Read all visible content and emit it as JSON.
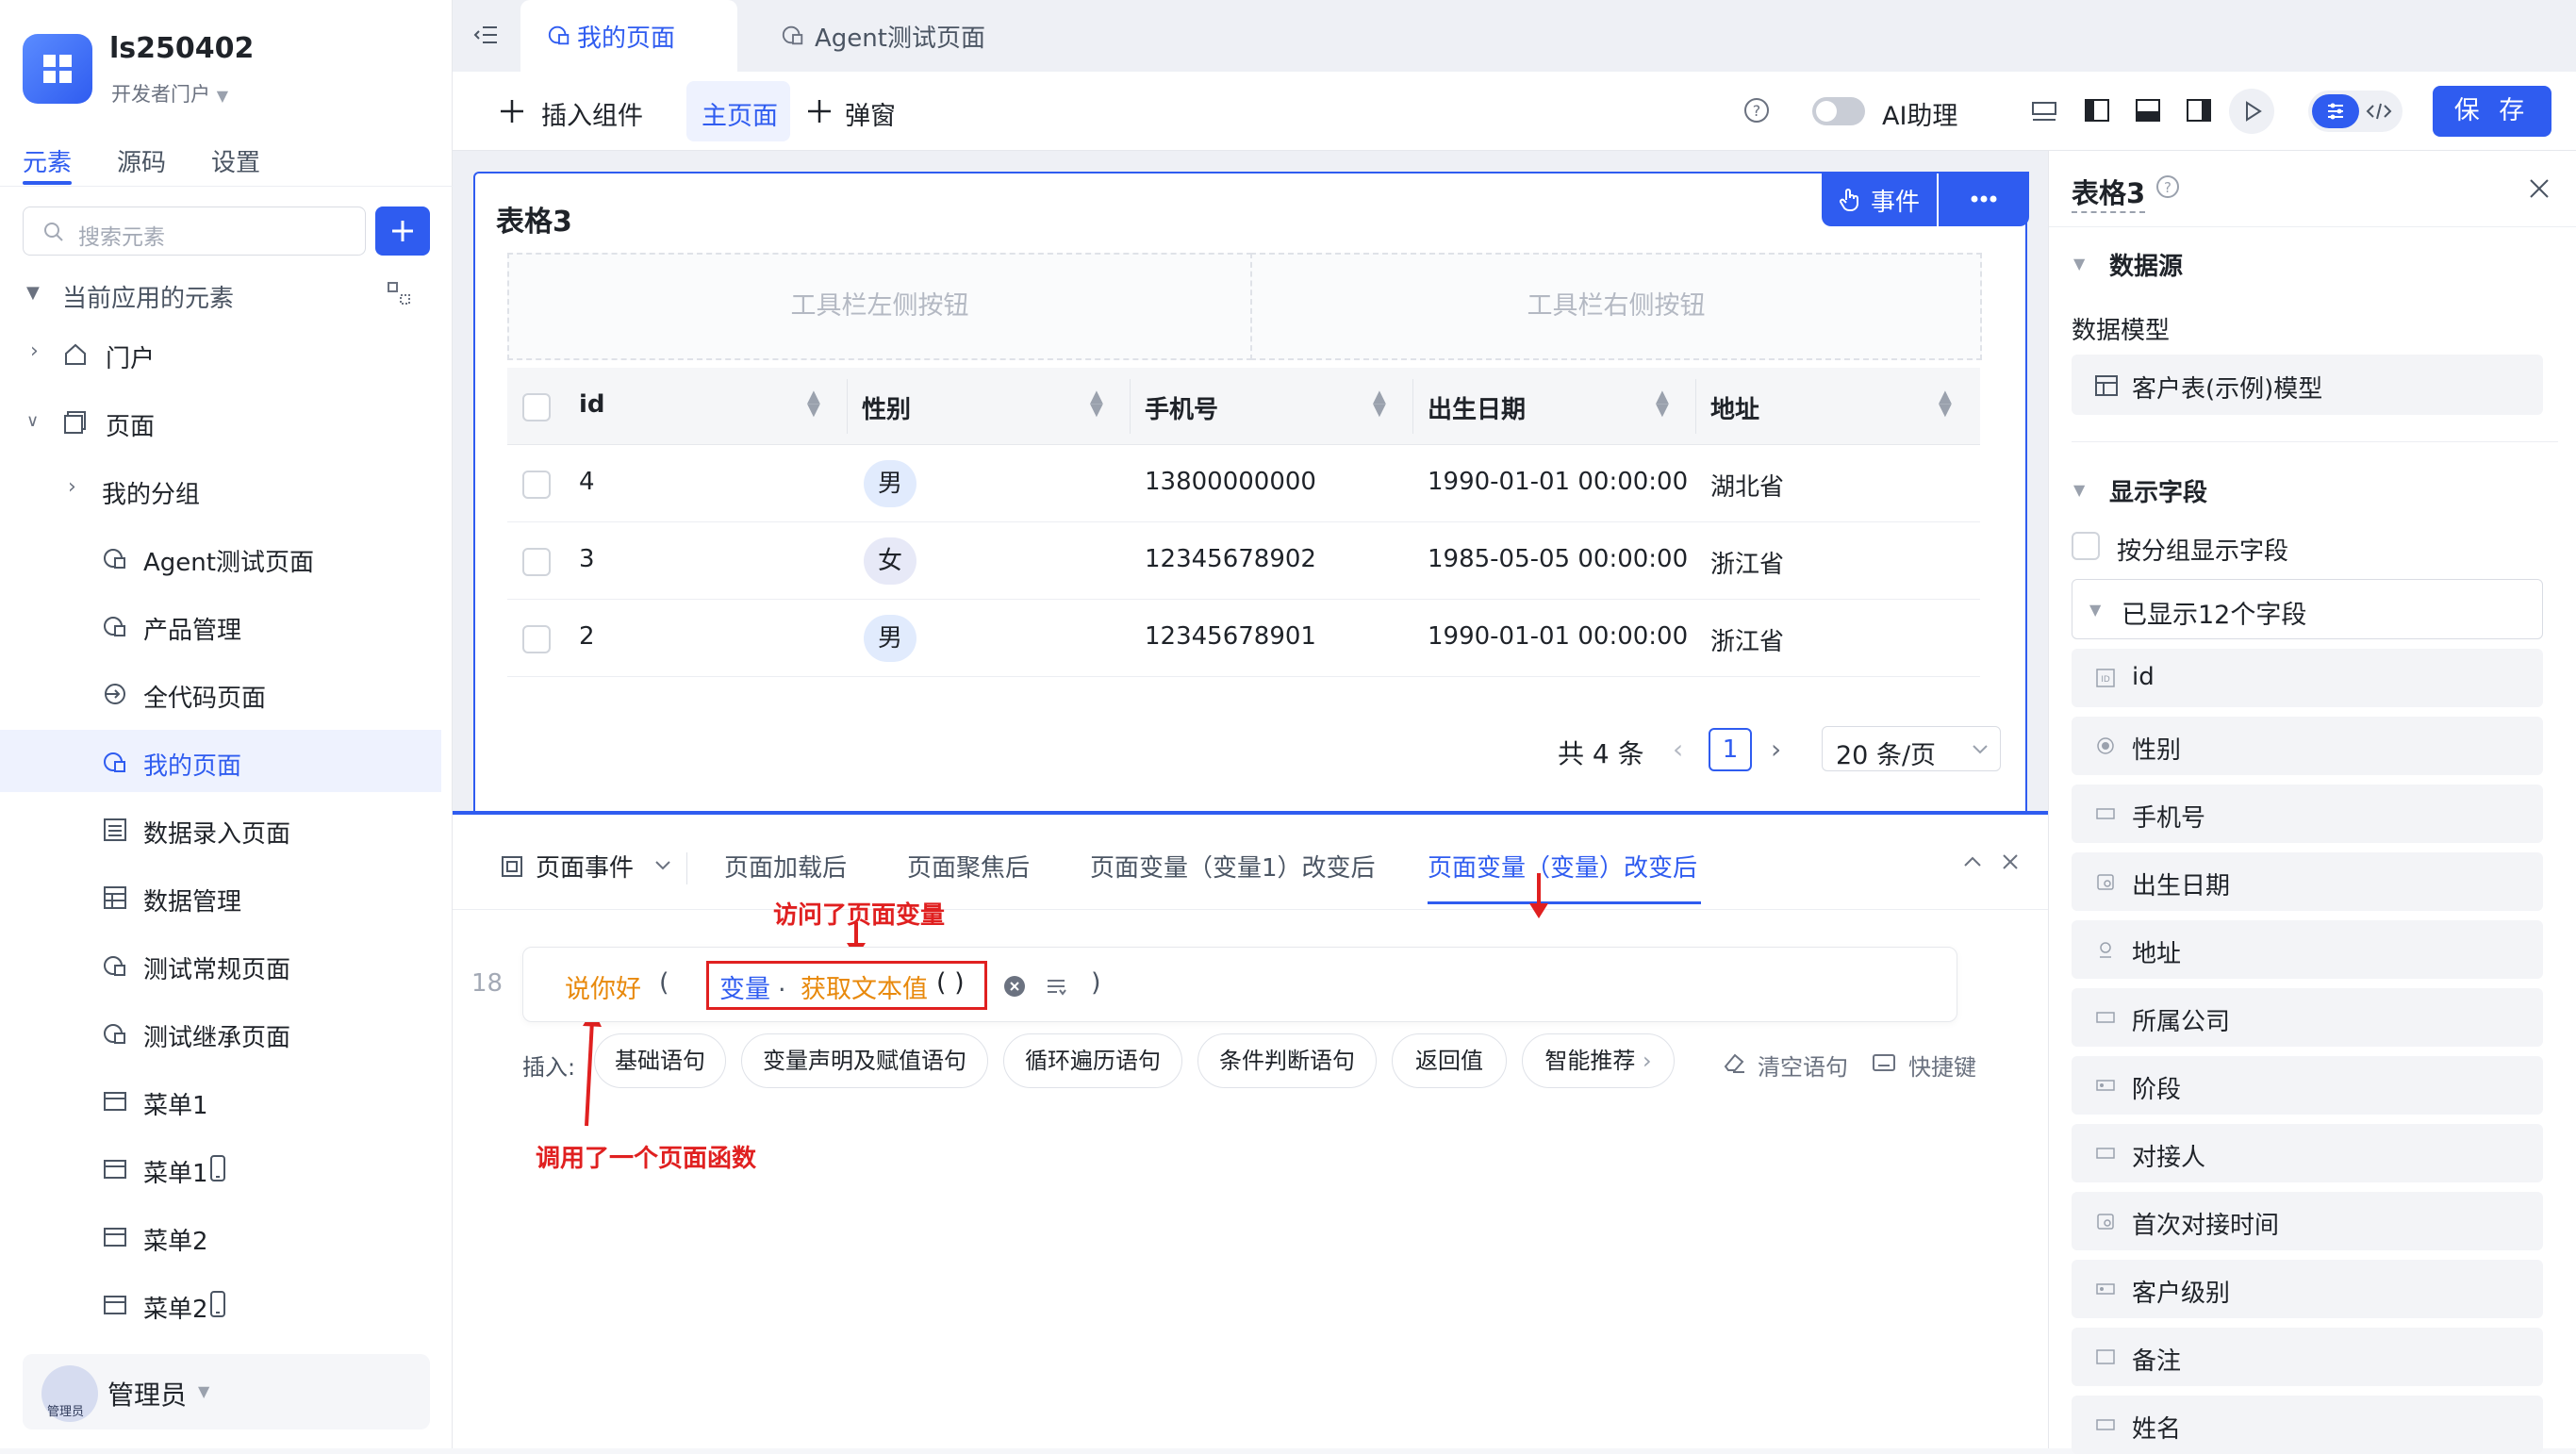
{
  "app": {
    "name": "ls250402",
    "subtitle": "开发者门户"
  },
  "sidebar": {
    "tabs": [
      "元素",
      "源码",
      "设置"
    ],
    "search_placeholder": "搜索元素",
    "section": "当前应用的元素",
    "items": [
      {
        "label": "门户"
      },
      {
        "label": "页面"
      },
      {
        "label": "我的分组"
      },
      {
        "label": "Agent测试页面"
      },
      {
        "label": "产品管理"
      },
      {
        "label": "全代码页面"
      },
      {
        "label": "我的页面"
      },
      {
        "label": "数据录入页面"
      },
      {
        "label": "数据管理"
      },
      {
        "label": "测试常规页面"
      },
      {
        "label": "测试继承页面"
      },
      {
        "label": "菜单1"
      },
      {
        "label": "菜单1"
      },
      {
        "label": "菜单2"
      },
      {
        "label": "菜单2"
      }
    ],
    "user": "管理员",
    "avatar_text": "管理员"
  },
  "page_tabs": [
    "我的页面",
    "Agent测试页面"
  ],
  "toolbar": {
    "insert": "插入组件",
    "main_page": "主页面",
    "popup": "弹窗",
    "ai": "AI助理",
    "save": "保 存"
  },
  "table_card": {
    "title": "表格3",
    "event_btn": "事件",
    "left_slot": "工具栏左侧按钮",
    "right_slot": "工具栏右侧按钮",
    "columns": [
      "id",
      "性别",
      "手机号",
      "出生日期",
      "地址"
    ],
    "rows": [
      {
        "id": "4",
        "gender": "男",
        "phone": "13800000000",
        "birth": "1990-01-01 00:00:00",
        "addr": "湖北省"
      },
      {
        "id": "3",
        "gender": "女",
        "phone": "12345678902",
        "birth": "1985-05-05 00:00:00",
        "addr": "浙江省"
      },
      {
        "id": "2",
        "gender": "男",
        "phone": "12345678901",
        "birth": "1990-01-01 00:00:00",
        "addr": "浙江省"
      }
    ],
    "total": "共 4 条",
    "page": "1",
    "page_size": "20 条/页"
  },
  "event_panel": {
    "menu": "页面事件",
    "tabs": [
      "页面加载后",
      "页面聚焦后",
      "页面变量（变量1）改变后",
      "页面变量（变量）改变后"
    ],
    "line_no": "18",
    "code": {
      "func": "说你好",
      "open": "(",
      "var": "变量",
      "dot": ".",
      "method": "获取文本值",
      "call": "( )",
      "close": ")"
    },
    "insert_label": "插入:",
    "chips": [
      "基础语句",
      "变量声明及赋值语句",
      "循环遍历语句",
      "条件判断语句",
      "返回值",
      "智能推荐"
    ],
    "clear": "清空语句",
    "shortcut": "快捷键",
    "annotation_top": "访问了页面变量",
    "annotation_bottom": "调用了一个页面函数"
  },
  "right_panel": {
    "title": "表格3",
    "datasource": "数据源",
    "model_label": "数据模型",
    "model": "客户表(示例)模型",
    "fields_section": "显示字段",
    "group_check": "按分组显示字段",
    "shown": "已显示12个字段",
    "fields": [
      "id",
      "性别",
      "手机号",
      "出生日期",
      "地址",
      "所属公司",
      "阶段",
      "对接人",
      "首次对接时间",
      "客户级别",
      "备注",
      "姓名"
    ]
  },
  "colors": {
    "accent": "#2f5cf0",
    "annotation": "#e02020",
    "func": "#e8890c"
  }
}
